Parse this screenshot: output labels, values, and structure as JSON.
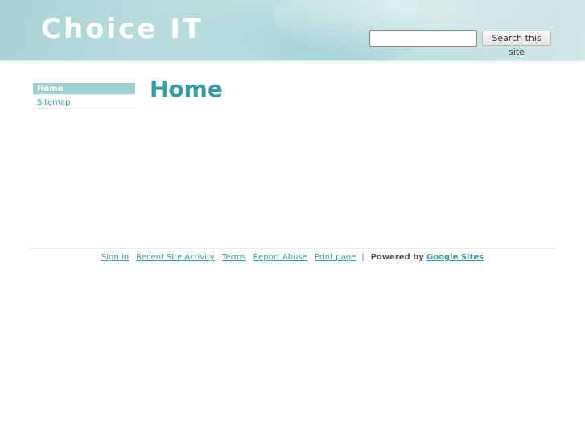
{
  "header": {
    "site_title": "Choice IT",
    "search_placeholder": "",
    "search_button_label": "Search this site"
  },
  "sidebar": {
    "items": [
      {
        "label": "Home",
        "active": true
      },
      {
        "label": "Sitemap",
        "active": false
      }
    ]
  },
  "main": {
    "page_title": "Home"
  },
  "footer": {
    "links": [
      "Sign in",
      "Recent Site Activity",
      "Terms",
      "Report Abuse",
      "Print page"
    ],
    "separator": "|",
    "powered_by": "Powered by",
    "google_sites": "Google Sites"
  },
  "colors": {
    "accent": "#3a9aa3",
    "nav_active_bg": "#9fcfd2",
    "header_bg": "#b9dcdd"
  }
}
